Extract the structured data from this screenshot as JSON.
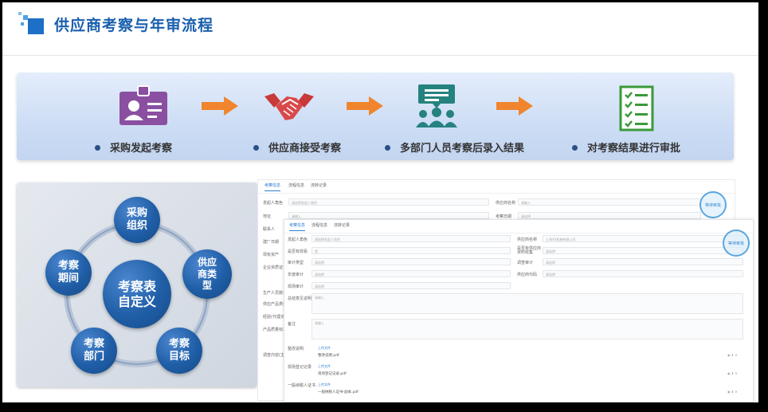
{
  "header": {
    "title": "供应商考察与年审流程"
  },
  "steps": [
    {
      "label": "采购发起考察",
      "icon": "id-card-icon"
    },
    {
      "label": "供应商接受考察",
      "icon": "handshake-icon"
    },
    {
      "label": "多部门人员考察后录入结果",
      "icon": "team-meeting-icon"
    },
    {
      "label": "对考察结果进行审批",
      "icon": "checklist-icon"
    }
  ],
  "colors": {
    "accent": "#1a5fae",
    "arrow": "#f0852d",
    "icon_purple": "#8a4fa0",
    "icon_red": "#c8393a",
    "icon_teal": "#25827e",
    "icon_green": "#3a9a3a"
  },
  "cycle": {
    "center": "考察表\n自定义",
    "nodes": [
      "采购\n组织",
      "供应\n商类\n型",
      "考察\n目标",
      "考察\n部门",
      "考察\n期间"
    ]
  },
  "form_back": {
    "tabs": [
      "考察信息",
      "流程信息",
      "流转记录"
    ],
    "fields": [
      {
        "label": "发起人角色",
        "placeholder": "请选择发起人角色"
      },
      {
        "label": "供应商名称",
        "placeholder": "请输入"
      },
      {
        "label": "地址",
        "placeholder": "请输入"
      },
      {
        "label": "考察日期",
        "placeholder": "请选择"
      }
    ],
    "labels": [
      "联系人",
      "建厂日期",
      "现有资产",
      "企业资质证书",
      "生产人员数量",
      "供应产品类型",
      "经验(代理)模型(年限)",
      "产品质量标准",
      "调查内容(主要产品等级)"
    ],
    "stamp": "等待审批"
  },
  "form_front": {
    "tabs": [
      "考察信息",
      "流程信息",
      "流转记录"
    ],
    "fields": [
      {
        "label": "发起人角色",
        "placeholder": "请选择发起人角色"
      },
      {
        "label": "供应商名称",
        "placeholder": "上海XX机械有限公司"
      },
      {
        "label": "是否有效看",
        "placeholder": "是"
      },
      {
        "label": "是否有供应商资料收集",
        "placeholder": "请选择"
      },
      {
        "label": "审计类型",
        "placeholder": "请选择"
      },
      {
        "label": "调查审计",
        "placeholder": "请选择"
      },
      {
        "label": "年度审计",
        "placeholder": "请选择"
      },
      {
        "label": "供应商代码",
        "placeholder": "请选择"
      },
      {
        "label": "现场审计",
        "placeholder": "请选择"
      }
    ],
    "textareas": [
      {
        "label": "总结意见说明",
        "placeholder": "请输入"
      },
      {
        "label": "备注",
        "placeholder": "请输入"
      }
    ],
    "attachments": [
      {
        "label": "整改说明",
        "upload": "上传文件",
        "file": "整改说明.pdf"
      },
      {
        "label": "现场登记记录",
        "upload": "上传文件",
        "file": "现场登记记录.pdf"
      },
      {
        "label": "一般纳税人证书",
        "upload": "上传文件",
        "file": "一般纳税人证书-副本.pdf"
      }
    ],
    "stamp": "等待审批"
  }
}
